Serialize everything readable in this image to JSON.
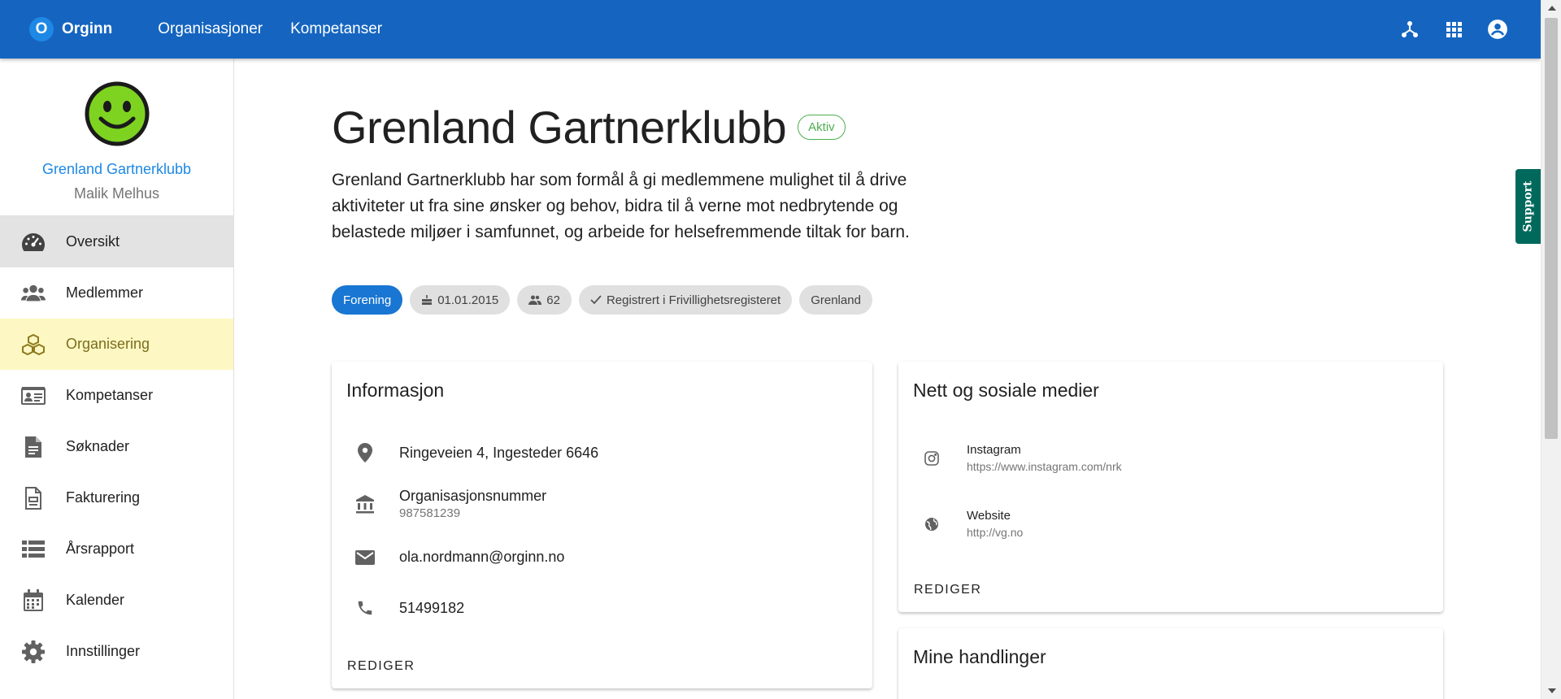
{
  "appbar": {
    "brand_letter": "O",
    "brand_name": "Orginn",
    "nav": [
      "Organisasjoner",
      "Kompetanser"
    ],
    "icons": [
      "org-chart-icon",
      "apps-grid-icon",
      "account-circle-icon"
    ]
  },
  "sidebar": {
    "org_name": "Grenland Gartnerklubb",
    "user_name": "Malik Melhus",
    "items": [
      {
        "label": "Oversikt",
        "icon": "speedometer-icon",
        "state": "active"
      },
      {
        "label": "Medlemmer",
        "icon": "people-icon",
        "state": ""
      },
      {
        "label": "Organisering",
        "icon": "cubes-icon",
        "state": "highlight"
      },
      {
        "label": "Kompetanser",
        "icon": "id-card-icon",
        "state": ""
      },
      {
        "label": "Søknader",
        "icon": "document-icon",
        "state": ""
      },
      {
        "label": "Fakturering",
        "icon": "invoice-icon",
        "state": ""
      },
      {
        "label": "Årsrapport",
        "icon": "list-icon",
        "state": ""
      },
      {
        "label": "Kalender",
        "icon": "calendar-icon",
        "state": ""
      },
      {
        "label": "Innstillinger",
        "icon": "gear-icon",
        "state": ""
      }
    ]
  },
  "main": {
    "title": "Grenland Gartnerklubb",
    "status": "Aktiv",
    "description": "Grenland Gartnerklubb har som formål å gi medlemmene mulighet til å drive aktiviteter ut fra sine ønsker og behov, bidra til å verne mot nedbrytende og belastede miljøer i samfunnet, og arbeide for helsefremmende tiltak for barn.",
    "chips": {
      "type": "Forening",
      "founded": "01.01.2015",
      "members": "62",
      "registered": "Registrert i Frivillighetsregisteret",
      "region": "Grenland"
    }
  },
  "info_card": {
    "title": "Informasjon",
    "address": "Ringeveien 4, Ingesteder 6646",
    "orgnr_label": "Organisasjonsnummer",
    "orgnr_value": "987581239",
    "email": "ola.nordmann@orginn.no",
    "phone": "51499182",
    "edit_label": "REDIGER"
  },
  "social_card": {
    "title": "Nett og sosiale medier",
    "items": [
      {
        "name": "Instagram",
        "url": "https://www.instagram.com/nrk",
        "icon": "instagram-icon"
      },
      {
        "name": "Website",
        "url": "http://vg.no",
        "icon": "globe-icon"
      }
    ],
    "edit_label": "REDIGER"
  },
  "actions_card": {
    "title": "Mine handlinger"
  },
  "support_label": "Support",
  "colors": {
    "appbar": "#1565c0",
    "link": "#1e88e5",
    "active_status": "#4caf50",
    "highlight": "#fdf8c3",
    "support": "#00695c"
  }
}
